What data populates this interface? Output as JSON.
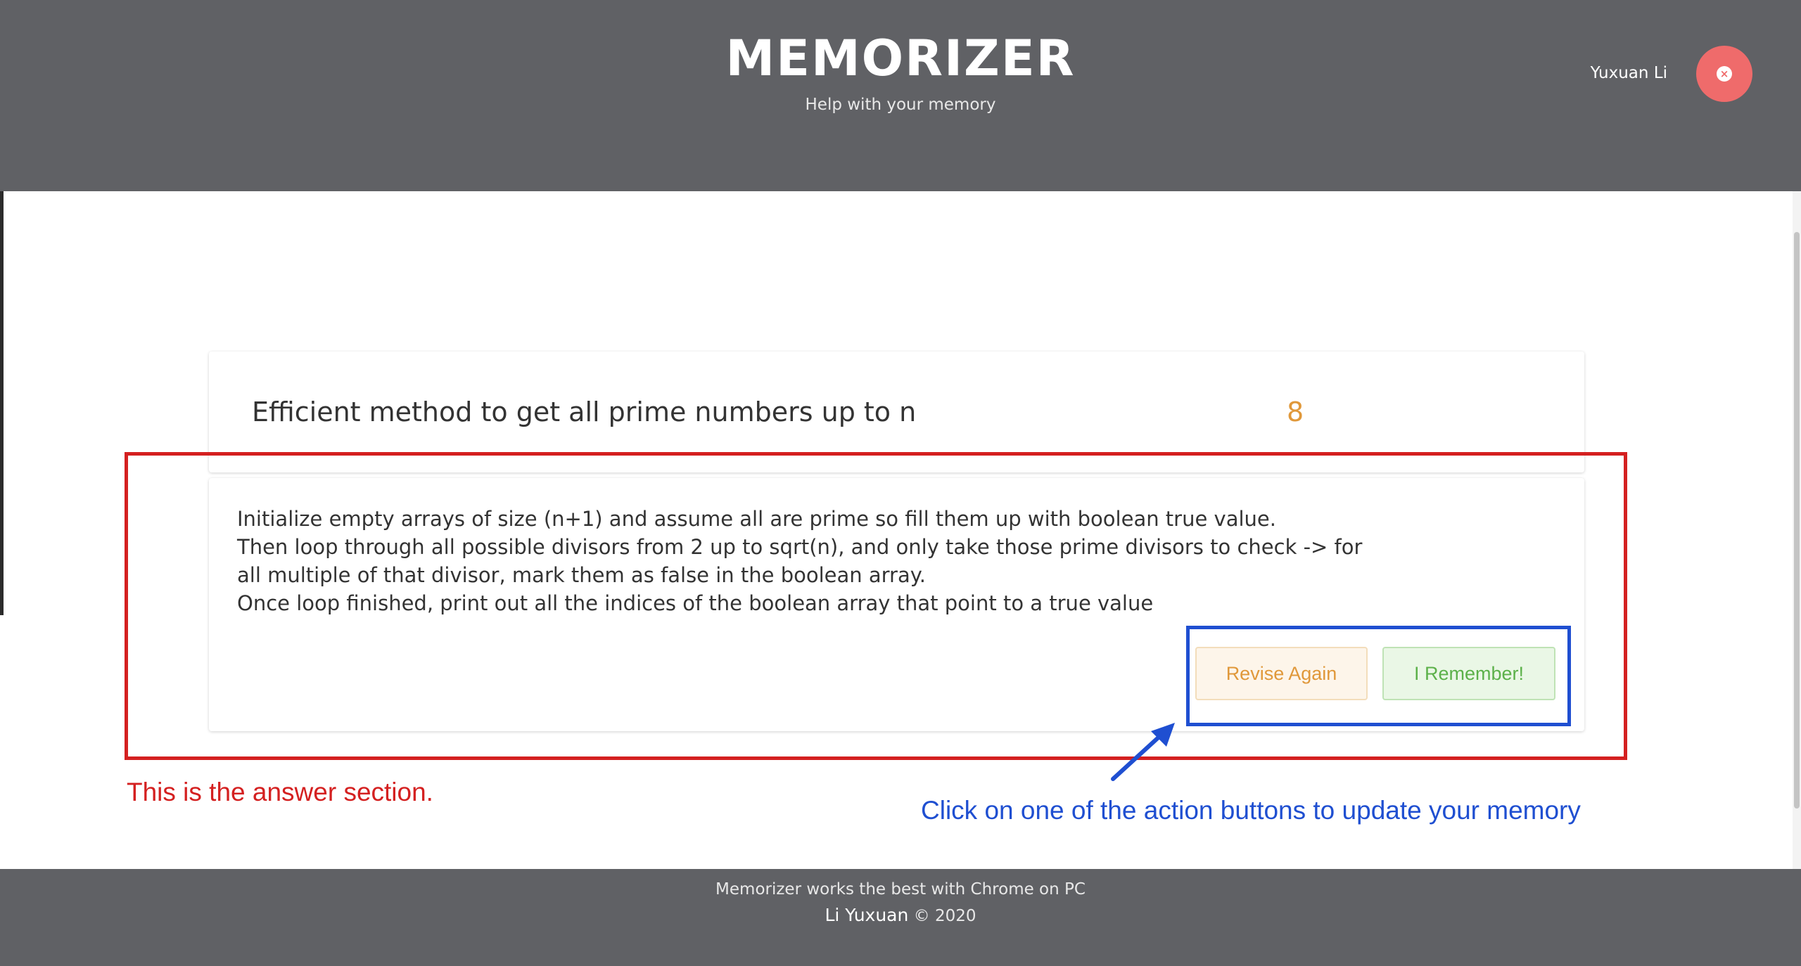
{
  "header": {
    "title": "MEMORIZER",
    "subtitle": "Help with your memory",
    "user_name": "Yuxuan Li",
    "logout_icon": "close-circle-icon",
    "logout_glyph": "×"
  },
  "question_card": {
    "question": "Efficient method to get all prime numbers up to n",
    "count": "8"
  },
  "answer_card": {
    "lines": [
      "Initialize empty arrays of size (n+1) and assume all are prime so fill them up with boolean true value.",
      "Then loop through all possible divisors from 2 up to sqrt(n), and only take those prime divisors to check -> for all multiple of that divisor, mark them as false in the boolean array.",
      "Once loop finished, print out all the indices of the boolean array that point to a true value"
    ],
    "revise_label": "Revise Again",
    "remember_label": "I Remember!"
  },
  "annotations": {
    "answer_note": "This is the answer section.",
    "buttons_note": "Click on one of the action buttons to update your memory",
    "red_color": "#d42020",
    "blue_color": "#1f4fd1"
  },
  "footer": {
    "line1": "Memorizer works the best with Chrome on PC",
    "author": "Li Yuxuan",
    "copyright": "© 2020"
  },
  "colors": {
    "header_bg": "#606165",
    "accent_orange": "#e0983a",
    "accent_green": "#5cb14a",
    "logout_red": "#ef6b6b"
  }
}
